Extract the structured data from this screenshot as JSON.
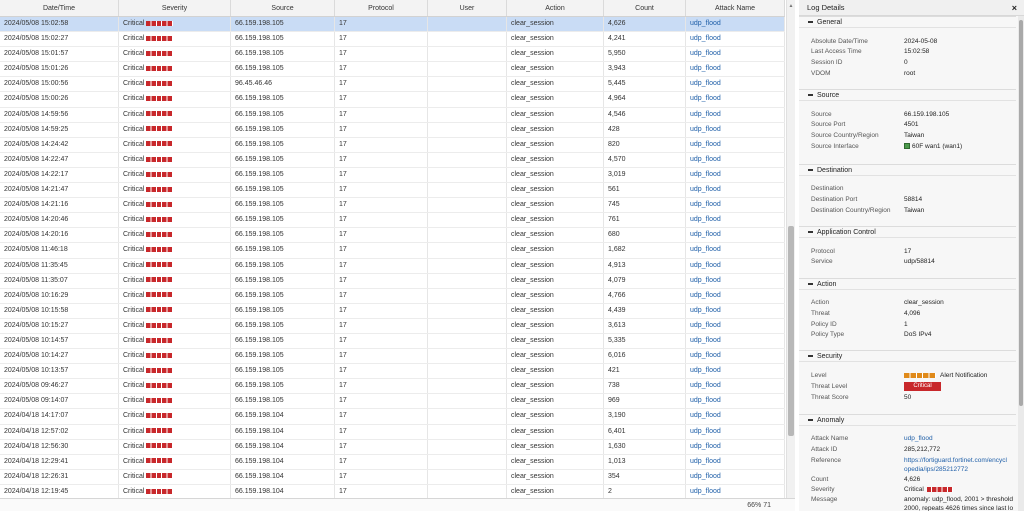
{
  "table": {
    "columns": [
      "Date/Time",
      "Severity",
      "Source",
      "Protocol",
      "User",
      "Action",
      "Count",
      "Attack Name"
    ],
    "rows": [
      {
        "date": "2024/05/08 15:02:58",
        "severity": "Critical",
        "source": "66.159.198.105",
        "protocol": "17",
        "user": "",
        "action": "clear_session",
        "count": "4,626",
        "attack": "udp_flood"
      },
      {
        "date": "2024/05/08 15:02:27",
        "severity": "Critical",
        "source": "66.159.198.105",
        "protocol": "17",
        "user": "",
        "action": "clear_session",
        "count": "4,241",
        "attack": "udp_flood"
      },
      {
        "date": "2024/05/08 15:01:57",
        "severity": "Critical",
        "source": "66.159.198.105",
        "protocol": "17",
        "user": "",
        "action": "clear_session",
        "count": "5,950",
        "attack": "udp_flood"
      },
      {
        "date": "2024/05/08 15:01:26",
        "severity": "Critical",
        "source": "66.159.198.105",
        "protocol": "17",
        "user": "",
        "action": "clear_session",
        "count": "3,943",
        "attack": "udp_flood"
      },
      {
        "date": "2024/05/08 15:00:56",
        "severity": "Critical",
        "source": "96.45.46.46",
        "protocol": "17",
        "user": "",
        "action": "clear_session",
        "count": "5,445",
        "attack": "udp_flood"
      },
      {
        "date": "2024/05/08 15:00:26",
        "severity": "Critical",
        "source": "66.159.198.105",
        "protocol": "17",
        "user": "",
        "action": "clear_session",
        "count": "4,964",
        "attack": "udp_flood"
      },
      {
        "date": "2024/05/08 14:59:56",
        "severity": "Critical",
        "source": "66.159.198.105",
        "protocol": "17",
        "user": "",
        "action": "clear_session",
        "count": "4,546",
        "attack": "udp_flood"
      },
      {
        "date": "2024/05/08 14:59:25",
        "severity": "Critical",
        "source": "66.159.198.105",
        "protocol": "17",
        "user": "",
        "action": "clear_session",
        "count": "428",
        "attack": "udp_flood"
      },
      {
        "date": "2024/05/08 14:24:42",
        "severity": "Critical",
        "source": "66.159.198.105",
        "protocol": "17",
        "user": "",
        "action": "clear_session",
        "count": "820",
        "attack": "udp_flood"
      },
      {
        "date": "2024/05/08 14:22:47",
        "severity": "Critical",
        "source": "66.159.198.105",
        "protocol": "17",
        "user": "",
        "action": "clear_session",
        "count": "4,570",
        "attack": "udp_flood"
      },
      {
        "date": "2024/05/08 14:22:17",
        "severity": "Critical",
        "source": "66.159.198.105",
        "protocol": "17",
        "user": "",
        "action": "clear_session",
        "count": "3,019",
        "attack": "udp_flood"
      },
      {
        "date": "2024/05/08 14:21:47",
        "severity": "Critical",
        "source": "66.159.198.105",
        "protocol": "17",
        "user": "",
        "action": "clear_session",
        "count": "561",
        "attack": "udp_flood"
      },
      {
        "date": "2024/05/08 14:21:16",
        "severity": "Critical",
        "source": "66.159.198.105",
        "protocol": "17",
        "user": "",
        "action": "clear_session",
        "count": "745",
        "attack": "udp_flood"
      },
      {
        "date": "2024/05/08 14:20:46",
        "severity": "Critical",
        "source": "66.159.198.105",
        "protocol": "17",
        "user": "",
        "action": "clear_session",
        "count": "761",
        "attack": "udp_flood"
      },
      {
        "date": "2024/05/08 14:20:16",
        "severity": "Critical",
        "source": "66.159.198.105",
        "protocol": "17",
        "user": "",
        "action": "clear_session",
        "count": "680",
        "attack": "udp_flood"
      },
      {
        "date": "2024/05/08 11:46:18",
        "severity": "Critical",
        "source": "66.159.198.105",
        "protocol": "17",
        "user": "",
        "action": "clear_session",
        "count": "1,682",
        "attack": "udp_flood"
      },
      {
        "date": "2024/05/08 11:35:45",
        "severity": "Critical",
        "source": "66.159.198.105",
        "protocol": "17",
        "user": "",
        "action": "clear_session",
        "count": "4,913",
        "attack": "udp_flood"
      },
      {
        "date": "2024/05/08 11:35:07",
        "severity": "Critical",
        "source": "66.159.198.105",
        "protocol": "17",
        "user": "",
        "action": "clear_session",
        "count": "4,079",
        "attack": "udp_flood"
      },
      {
        "date": "2024/05/08 10:16:29",
        "severity": "Critical",
        "source": "66.159.198.105",
        "protocol": "17",
        "user": "",
        "action": "clear_session",
        "count": "4,766",
        "attack": "udp_flood"
      },
      {
        "date": "2024/05/08 10:15:58",
        "severity": "Critical",
        "source": "66.159.198.105",
        "protocol": "17",
        "user": "",
        "action": "clear_session",
        "count": "4,439",
        "attack": "udp_flood"
      },
      {
        "date": "2024/05/08 10:15:27",
        "severity": "Critical",
        "source": "66.159.198.105",
        "protocol": "17",
        "user": "",
        "action": "clear_session",
        "count": "3,613",
        "attack": "udp_flood"
      },
      {
        "date": "2024/05/08 10:14:57",
        "severity": "Critical",
        "source": "66.159.198.105",
        "protocol": "17",
        "user": "",
        "action": "clear_session",
        "count": "5,335",
        "attack": "udp_flood"
      },
      {
        "date": "2024/05/08 10:14:27",
        "severity": "Critical",
        "source": "66.159.198.105",
        "protocol": "17",
        "user": "",
        "action": "clear_session",
        "count": "6,016",
        "attack": "udp_flood"
      },
      {
        "date": "2024/05/08 10:13:57",
        "severity": "Critical",
        "source": "66.159.198.105",
        "protocol": "17",
        "user": "",
        "action": "clear_session",
        "count": "421",
        "attack": "udp_flood"
      },
      {
        "date": "2024/05/08 09:46:27",
        "severity": "Critical",
        "source": "66.159.198.105",
        "protocol": "17",
        "user": "",
        "action": "clear_session",
        "count": "738",
        "attack": "udp_flood"
      },
      {
        "date": "2024/05/08 09:14:07",
        "severity": "Critical",
        "source": "66.159.198.105",
        "protocol": "17",
        "user": "",
        "action": "clear_session",
        "count": "969",
        "attack": "udp_flood"
      },
      {
        "date": "2024/04/18 14:17:07",
        "severity": "Critical",
        "source": "66.159.198.104",
        "protocol": "17",
        "user": "",
        "action": "clear_session",
        "count": "3,190",
        "attack": "udp_flood"
      },
      {
        "date": "2024/04/18 12:57:02",
        "severity": "Critical",
        "source": "66.159.198.104",
        "protocol": "17",
        "user": "",
        "action": "clear_session",
        "count": "6,401",
        "attack": "udp_flood"
      },
      {
        "date": "2024/04/18 12:56:30",
        "severity": "Critical",
        "source": "66.159.198.104",
        "protocol": "17",
        "user": "",
        "action": "clear_session",
        "count": "1,630",
        "attack": "udp_flood"
      },
      {
        "date": "2024/04/18 12:29:41",
        "severity": "Critical",
        "source": "66.159.198.104",
        "protocol": "17",
        "user": "",
        "action": "clear_session",
        "count": "1,013",
        "attack": "udp_flood"
      },
      {
        "date": "2024/04/18 12:26:31",
        "severity": "Critical",
        "source": "66.159.198.104",
        "protocol": "17",
        "user": "",
        "action": "clear_session",
        "count": "354",
        "attack": "udp_flood"
      },
      {
        "date": "2024/04/18 12:19:45",
        "severity": "Critical",
        "source": "66.159.198.104",
        "protocol": "17",
        "user": "",
        "action": "clear_session",
        "count": "2",
        "attack": "udp_flood"
      }
    ],
    "selected_row": 0,
    "status": "66% 71"
  },
  "details": {
    "title": "Log Details",
    "close_glyph": "×",
    "general": {
      "heading": "General",
      "absolute_date_label": "Absolute Date/Time",
      "absolute_date": "2024-05-08",
      "last_access_label": "Last Access Time",
      "last_access": "15:02:58",
      "session_id_label": "Session ID",
      "session_id": "0",
      "vdom_label": "VDOM",
      "vdom": "root"
    },
    "source": {
      "heading": "Source",
      "source_label": "Source",
      "source": "66.159.198.105",
      "port_label": "Source Port",
      "port": "4501",
      "country_label": "Source Country/Region",
      "country": "Taiwan",
      "iface_label": "Source Interface",
      "iface": "60F wan1 (wan1)",
      "iface_icon": "network-interface-icon"
    },
    "destination": {
      "heading": "Destination",
      "dest_label": "Destination",
      "port_label": "Destination Port",
      "port": "58814",
      "country_label": "Destination Country/Region",
      "country": "Taiwan"
    },
    "app_control": {
      "heading": "Application Control",
      "protocol_label": "Protocol",
      "protocol": "17",
      "service_label": "Service",
      "service": "udp/58814"
    },
    "action": {
      "heading": "Action",
      "action_label": "Action",
      "action": "clear_session",
      "threat_label": "Threat",
      "threat": "4,096",
      "policy_id_label": "Policy ID",
      "policy_id": "1",
      "policy_type_label": "Policy Type",
      "policy_type": "DoS IPv4"
    },
    "security": {
      "heading": "Security",
      "level_label": "Level",
      "level": "Alert Notification",
      "threat_level_label": "Threat Level",
      "threat_level": "Critical",
      "threat_score_label": "Threat Score",
      "threat_score": "50"
    },
    "anomaly": {
      "heading": "Anomaly",
      "attack_name_label": "Attack Name",
      "attack_name": "udp_flood",
      "attack_id_label": "Attack ID",
      "attack_id": "285,212,772",
      "reference_label": "Reference",
      "reference": "https://fortiguard.fortinet.com/encyclopedia/ips/285212772",
      "count_label": "Count",
      "count": "4,626",
      "severity_label": "Severity",
      "severity": "Critical",
      "message_label": "Message",
      "message": "anomaly: udp_flood, 2001 > threshold 2000, repeats 4626 times since last lo"
    }
  },
  "colors": {
    "critical": "#c8282b",
    "alert": "#e08a1a",
    "selection": "#c9dcf5",
    "link": "#1f5fa8"
  }
}
